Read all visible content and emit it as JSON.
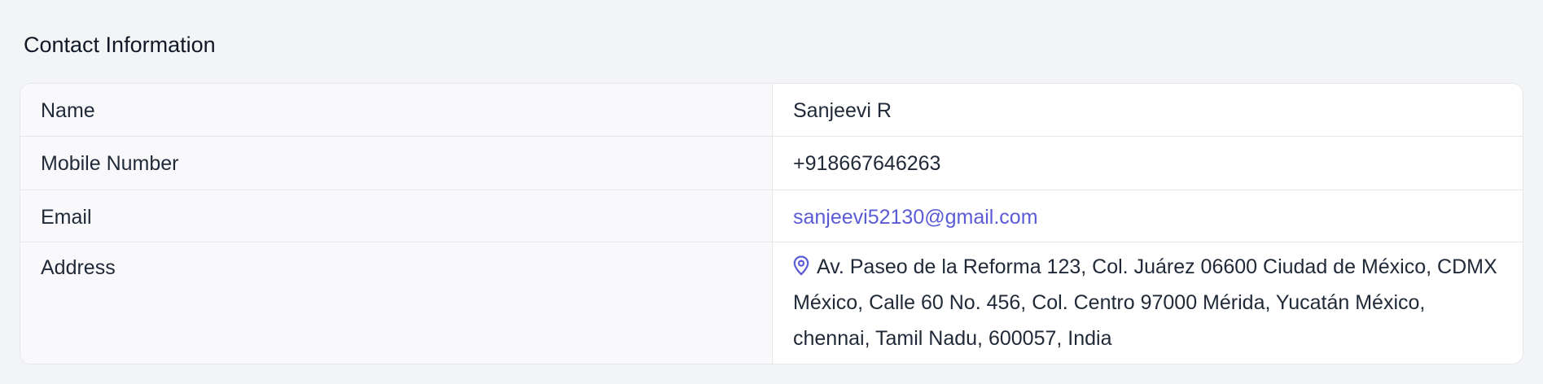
{
  "section": {
    "title": "Contact Information"
  },
  "contact": {
    "rows": [
      {
        "label": "Name",
        "value": "Sanjeevi R"
      },
      {
        "label": "Mobile Number",
        "value": "+918667646263"
      },
      {
        "label": "Email",
        "value": "sanjeevi52130@gmail.com"
      },
      {
        "label": "Address",
        "value": "Av. Paseo de la Reforma 123, Col. Juárez 06600 Ciudad de México, CDMX México, Calle 60 No. 456, Col. Centro 97000 Mérida, Yucatán México, chennai, Tamil Nadu, 600057, India"
      }
    ],
    "address_icon": "map-pin-icon"
  },
  "colors": {
    "page_background": "#f3f4f6",
    "label_background": "#f9f9fc",
    "accent": "#5b5bd6",
    "border": "#e5e7eb"
  }
}
